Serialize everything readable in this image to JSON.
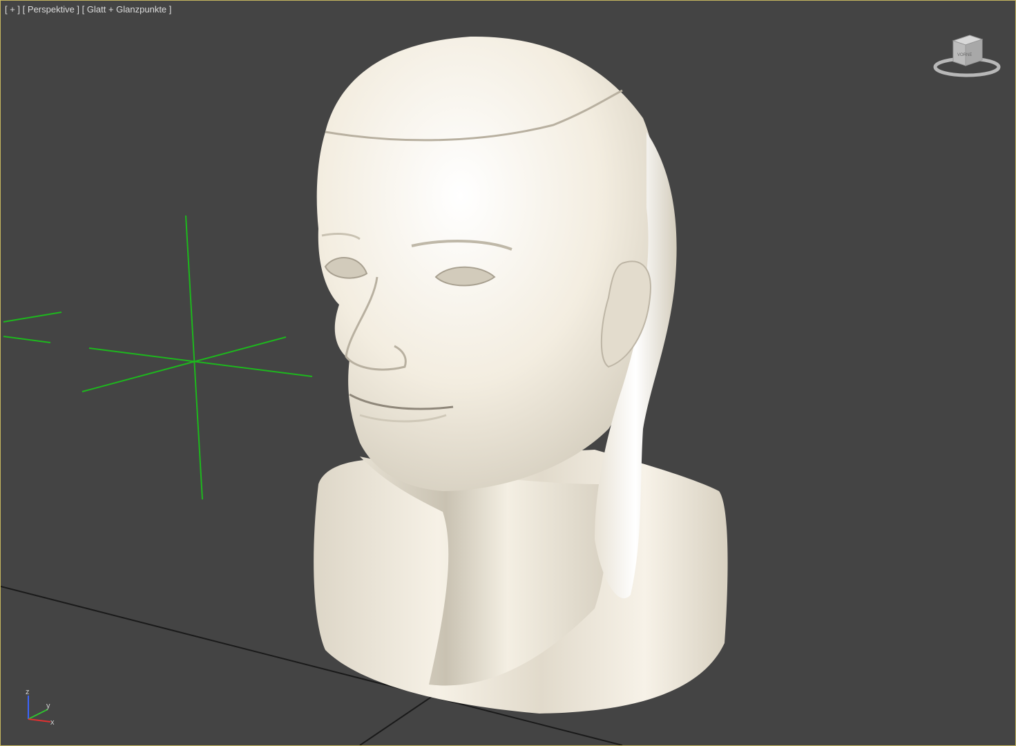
{
  "viewport": {
    "label_plus": "[ + ]",
    "label_view": "[ Perspektive ]",
    "label_shading": "[ Glatt + Glanzpunkte ]"
  },
  "viewcube": {
    "face_label": "VORNE"
  },
  "axis_tripod": {
    "z": "z",
    "y": "y",
    "x": "x"
  },
  "colors": {
    "viewport_bg": "#444444",
    "viewport_border": "#c8b860",
    "model": "#f2ecdf",
    "helper_green": "#1db81d",
    "grid_line": "#1a1a1a"
  }
}
